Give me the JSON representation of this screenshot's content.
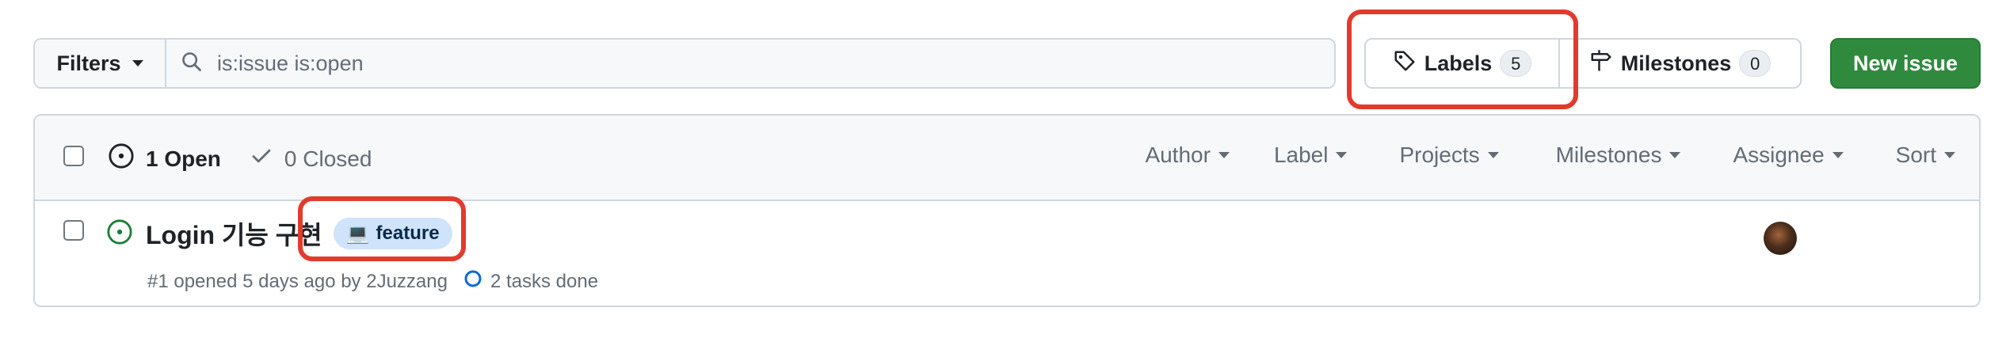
{
  "toolbar": {
    "filters_label": "Filters",
    "search_value": "is:issue is:open",
    "labels_label": "Labels",
    "labels_count": "5",
    "milestones_label": "Milestones",
    "milestones_count": "0",
    "new_issue_label": "New issue"
  },
  "issues_header": {
    "open_label": "1 Open",
    "closed_label": "0 Closed",
    "filters": [
      "Author",
      "Label",
      "Projects",
      "Milestones",
      "Assignee",
      "Sort"
    ]
  },
  "issues": [
    {
      "title": "Login 기능 구현",
      "label": {
        "emoji": "💻",
        "name": "feature",
        "color": "#cfe3fb"
      },
      "meta": "#1 opened 5 days ago by 2Juzzang",
      "tasks": "2 tasks done"
    }
  ],
  "colors": {
    "accent_green": "#2f8a3e",
    "open_icon_green": "#1a7f37",
    "annotation_red": "#e23b2e"
  }
}
